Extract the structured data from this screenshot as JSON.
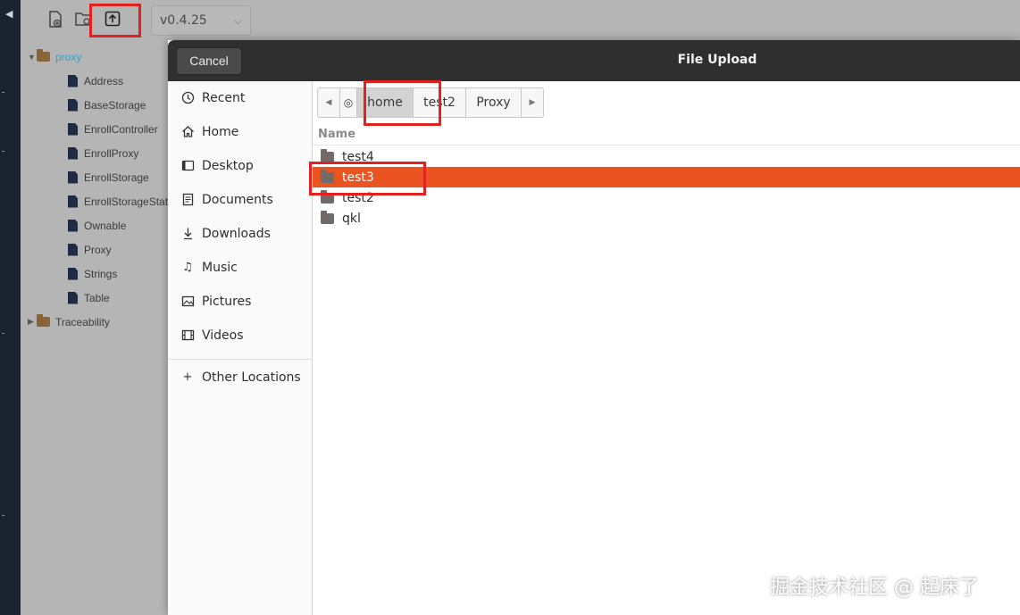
{
  "app": {
    "toolbar": {
      "icons": [
        "new-file-icon",
        "open-folder-icon",
        "upload-icon"
      ],
      "version": "v0.4.25"
    },
    "tree": {
      "root": {
        "label": "proxy",
        "color": "#2aa3d6"
      },
      "files": [
        "Address",
        "BaseStorage",
        "EnrollController",
        "EnrollProxy",
        "EnrollStorage",
        "EnrollStorageStat",
        "Ownable",
        "Proxy",
        "Strings",
        "Table"
      ],
      "collapsed_folder": "Traceability"
    }
  },
  "dialog": {
    "title": "File Upload",
    "cancel_label": "Cancel",
    "places": [
      {
        "label": "Recent",
        "icon": "clock-icon"
      },
      {
        "label": "Home",
        "icon": "home-icon"
      },
      {
        "label": "Desktop",
        "icon": "desktop-icon"
      },
      {
        "label": "Documents",
        "icon": "document-icon"
      },
      {
        "label": "Downloads",
        "icon": "download-icon"
      },
      {
        "label": "Music",
        "icon": "music-icon"
      },
      {
        "label": "Pictures",
        "icon": "picture-icon"
      },
      {
        "label": "Videos",
        "icon": "video-icon"
      }
    ],
    "other_locations": "Other Locations",
    "path": [
      "home",
      "test2",
      "Proxy"
    ],
    "column_name": "Name",
    "items": [
      {
        "name": "test4",
        "selected": false
      },
      {
        "name": "test3",
        "selected": true
      },
      {
        "name": "test2",
        "selected": false
      },
      {
        "name": "qkl",
        "selected": false
      }
    ],
    "accent_color": "#e95420"
  },
  "watermark": "掘金技术社区 @ 起床了"
}
